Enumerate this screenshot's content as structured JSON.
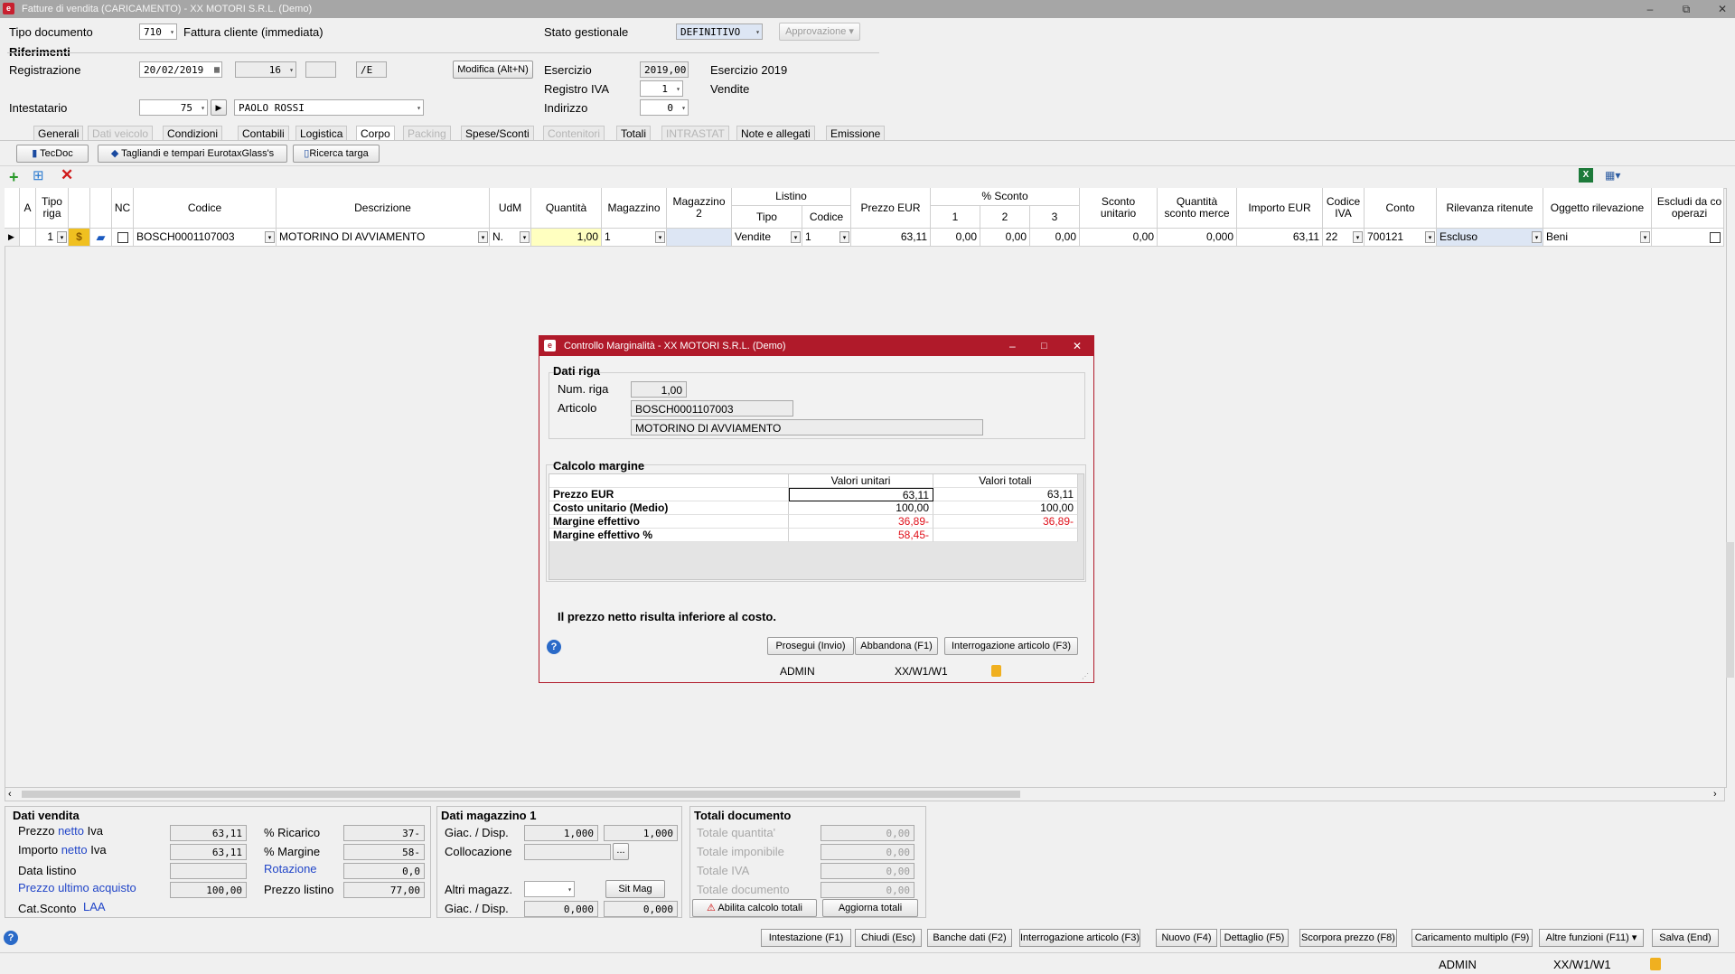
{
  "window": {
    "title": "Fatture di vendita (CARICAMENTO) - XX  MOTORI S.R.L.  (Demo)",
    "app_icon": "app-logo-icon",
    "controls": [
      "–",
      "⧉",
      "✕"
    ]
  },
  "header": {
    "tipo_documento_label": "Tipo documento",
    "tipo_documento_code": "710",
    "tipo_documento_desc": "Fattura cliente (immediata)",
    "stato_label": "Stato gestionale",
    "stato_value": "DEFINITIVO",
    "approvazione_label": "Approvazione",
    "riferimenti_label": "Riferimenti",
    "registrazione_label": "Registrazione",
    "registrazione_date": "20/02/2019",
    "registrazione_num": "16",
    "registrazione_suffix": "",
    "registrazione_sezionale": "/E",
    "modifica_button": "Modifica (Alt+N)",
    "esercizio_label": "Esercizio",
    "esercizio_value": "2019,00",
    "esercizio_desc": "Esercizio 2019",
    "registro_iva_label": "Registro IVA",
    "registro_iva_value": "1",
    "registro_iva_desc": "Vendite",
    "intestatario_label": "Intestatario",
    "intestatario_code": "75",
    "intestatario_name": "PAOLO ROSSI",
    "indirizzo_label": "Indirizzo",
    "indirizzo_value": "0"
  },
  "tabs": [
    {
      "label": "Generali",
      "disabled": false
    },
    {
      "label": "Dati veicolo",
      "disabled": true
    },
    {
      "label": "Condizioni",
      "disabled": false
    },
    {
      "label": "Contabili",
      "disabled": false
    },
    {
      "label": "Logistica",
      "disabled": false
    },
    {
      "label": "Corpo",
      "disabled": false,
      "active": true
    },
    {
      "label": "Packing",
      "disabled": true
    },
    {
      "label": "Spese/Sconti",
      "disabled": false
    },
    {
      "label": "Contenitori",
      "disabled": true
    },
    {
      "label": "Totali",
      "disabled": false
    },
    {
      "label": "INTRASTAT",
      "disabled": true
    },
    {
      "label": "Note e allegati",
      "disabled": false
    },
    {
      "label": "Emissione",
      "disabled": false
    }
  ],
  "subtoolbar": {
    "tecdoc": "TecDoc",
    "tagliandi": "Tagliandi e tempari EurotaxGlass's",
    "ricerca_targa": "Ricerca targa"
  },
  "grid": {
    "headers": {
      "a": "A",
      "tipo_riga": "Tipo riga",
      "nc": "NC",
      "codice": "Codice",
      "descrizione": "Descrizione",
      "udm": "UdM",
      "quantita": "Quantità",
      "magazzino": "Magazzino",
      "magazzino2": "Magazzino 2",
      "listino": "Listino",
      "listino_tipo": "Tipo",
      "listino_codice": "Codice",
      "prezzo": "Prezzo EUR",
      "sconto": "% Sconto",
      "sconto1": "1",
      "sconto2": "2",
      "sconto3": "3",
      "sconto_unitario": "Sconto unitario",
      "qta_sconto_merce": "Quantità sconto merce",
      "importo": "Importo EUR",
      "codice_iva": "Codice IVA",
      "conto": "Conto",
      "rilevanza": "Rilevanza ritenute",
      "oggetto": "Oggetto rilevazione",
      "escludi": "Escludi da co operazi"
    },
    "row": {
      "tipo_riga": "1",
      "codice": "BOSCH0001107003",
      "descrizione": "MOTORINO DI AVVIAMENTO",
      "udm": "N.",
      "quantita": "1,00",
      "magazzino": "1",
      "magazzino2": "",
      "listino_tipo": "Vendite",
      "listino_codice": "1",
      "prezzo": "63,11",
      "sconto1": "0,00",
      "sconto2": "0,00",
      "sconto3": "0,00",
      "sconto_unitario": "0,00",
      "qta_sconto_merce": "0,000",
      "importo": "63,11",
      "codice_iva": "22",
      "conto": "700121",
      "rilevanza": "Escluso",
      "oggetto": "Beni"
    }
  },
  "modal": {
    "title": "Controllo Marginalità - XX  MOTORI S.R.L.  (Demo)",
    "dati_riga_title": "Dati riga",
    "num_riga_label": "Num. riga",
    "num_riga_value": "1,00",
    "articolo_label": "Articolo",
    "articolo_code": "BOSCH0001107003",
    "articolo_desc": "MOTORINO DI AVVIAMENTO",
    "calcolo_title": "Calcolo margine",
    "col_unitari": "Valori unitari",
    "col_totali": "Valori totali",
    "rows": [
      {
        "label": "Prezzo EUR",
        "unit": "63,11",
        "tot": "63,11",
        "negative": false
      },
      {
        "label": "Costo unitario (Medio)",
        "unit": "100,00",
        "tot": "100,00",
        "negative": false
      },
      {
        "label": "Margine effettivo",
        "unit": "36,89-",
        "tot": "36,89-",
        "negative": true
      },
      {
        "label": "Margine effettivo %",
        "unit": "58,45-",
        "tot": "",
        "negative": true
      }
    ],
    "warning": "Il prezzo netto risulta inferiore al costo.",
    "btn_prosegui": "Prosegui (Invio)",
    "btn_abbandona": "Abbandona (F1)",
    "btn_interrogazione": "Interrogazione articolo (F3)",
    "status_user": "ADMIN",
    "status_path": "XX/W1/W1"
  },
  "dati_vendita": {
    "title": "Dati vendita",
    "prezzo_netto_iva_pre": "Prezzo ",
    "prezzo_netto_iva_mid": "netto",
    "prezzo_netto_iva_post": " Iva",
    "prezzo_netto_iva_value": "63,11",
    "importo_netto_iva_pre": "Importo ",
    "importo_netto_iva_mid": "netto",
    "importo_netto_iva_post": " Iva",
    "importo_netto_iva_value": "63,11",
    "data_listino_label": "Data listino",
    "data_listino_value": "",
    "prezzo_ultimo_acquisto_label": "Prezzo ultimo acquisto",
    "prezzo_ultimo_acquisto_value": "100,00",
    "cat_sconto_label": "Cat.Sconto",
    "cat_sconto_value": "LAA",
    "ricarico_label": "% Ricarico",
    "ricarico_value": "37-",
    "margine_label": "% Margine",
    "margine_value": "58-",
    "rotazione_label": "Rotazione",
    "rotazione_value": "0,0",
    "prezzo_listino_label": "Prezzo listino",
    "prezzo_listino_value": "77,00"
  },
  "dati_magazzino": {
    "title": "Dati magazzino 1",
    "giac_label": "Giac. / Disp.",
    "giac_value": "1,000",
    "disp_value": "1,000",
    "collocazione_label": "Collocazione",
    "collocazione_value": "",
    "altri_magazz_label": "Altri magazz.",
    "sit_mag_button": "Sit Mag",
    "giac2_label": "Giac. / Disp.",
    "giac2_value": "0,000",
    "disp2_value": "0,000"
  },
  "totali_documento": {
    "title": "Totali documento",
    "totale_quantita_label": "Totale quantita'",
    "totale_quantita_value": "0,00",
    "totale_imponibile_label": "Totale imponibile",
    "totale_imponibile_value": "0,00",
    "totale_iva_label": "Totale IVA",
    "totale_iva_value": "0,00",
    "totale_documento_label": "Totale documento",
    "totale_documento_value": "0,00",
    "abilita_button": "Abilita calcolo totali",
    "aggiorna_button": "Aggiorna totali"
  },
  "footer_buttons": [
    "Intestazione (F1)",
    "Chiudi (Esc)",
    "Banche dati (F2)",
    "Interrogazione articolo (F3)",
    "Nuovo (F4)",
    "Dettaglio (F5)",
    "Scorpora prezzo (F8)",
    "Caricamento multiplo (F9)",
    "Altre funzioni (F11)",
    "Salva (End)"
  ],
  "statusbar": {
    "user": "ADMIN",
    "path": "XX/W1/W1"
  },
  "colors": {
    "accent_red": "#b01a2a",
    "negative_red": "#e0101a",
    "link_blue": "#2246c8",
    "highlight_yellow": "#ffffc0"
  }
}
